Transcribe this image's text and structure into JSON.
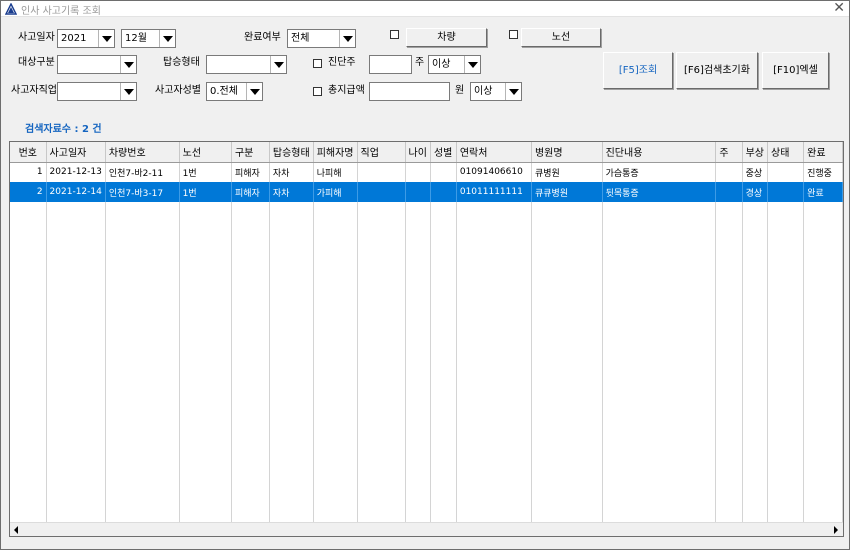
{
  "window": {
    "title": "인사 사고기록 조회",
    "close_glyph": "✕"
  },
  "filters": {
    "accident_date_label": "사고일자",
    "year_value": "2021",
    "month_value": "12월",
    "completion_label": "완료여부",
    "completion_value": "전체",
    "vehicle_button": "차량",
    "route_button": "노선",
    "target_label": "대상구분",
    "target_value": "",
    "boarding_label": "탑승형태",
    "boarding_value": "",
    "diagnosis_label": "진단주",
    "diagnosis_value": "",
    "diagnosis_unit": "주",
    "diagnosis_cmp": "이상",
    "job_label": "사고자직업",
    "job_value": "",
    "gender_label": "사고자성별",
    "gender_value": "0.전체",
    "total_amount_label": "총지급액",
    "total_amount_value": "",
    "amount_unit": "원",
    "amount_cmp": "이상"
  },
  "actions": {
    "search": "[F5]조회",
    "reset": "[F6]검색초기화",
    "excel": "[F10]엑셀"
  },
  "result_count_text": "검색자료수 : 2 건",
  "grid": {
    "columns": [
      "번호",
      "사고일자",
      "차량번호",
      "노선",
      "구분",
      "탑승형태",
      "피해자명",
      "직업",
      "나이",
      "성별",
      "연락처",
      "병원명",
      "진단내용",
      "주",
      "부상",
      "상태",
      "완료"
    ],
    "rows": [
      [
        "1",
        "2021-12-13",
        "인천7-바2-11",
        "1번",
        "피해자",
        "자차",
        "나피해",
        "",
        "",
        "",
        "01091406610",
        "큐병원",
        "가슴통증",
        "",
        "중상",
        "",
        "진행중"
      ],
      [
        "2",
        "2021-12-14",
        "인천7-바3-17",
        "1번",
        "피해자",
        "자차",
        "가피해",
        "",
        "",
        "",
        "01011111111",
        "큐큐병원",
        "뒷목통증",
        "",
        "경상",
        "",
        "완료"
      ]
    ]
  },
  "colors": {
    "selection": "#0078d7",
    "count_text": "#1565c0",
    "button_text": "#1565c0"
  }
}
